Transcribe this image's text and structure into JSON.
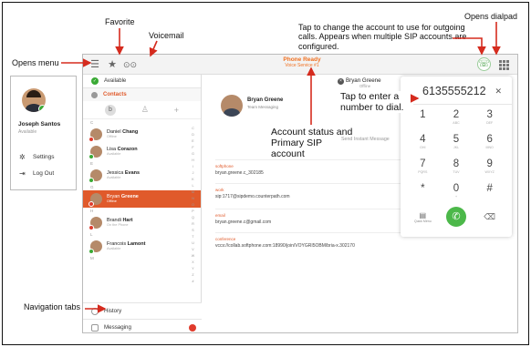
{
  "annotations": {
    "favorite": "Favorite",
    "voicemail": "Voicemail",
    "opens_menu": "Opens menu",
    "change_account": "Tap to change the account to use for outgoing calls. Appears when multiple SIP accounts are configured.",
    "opens_dialpad": "Opens dialpad",
    "tap_enter": "Tap to enter a number to dial.",
    "account_status": "Account status and Primary SIP account",
    "navigation_tabs": "Navigation tabs"
  },
  "topbar": {
    "status": "Phone Ready",
    "service": "Voice Service #1"
  },
  "menu": {
    "user_name": "Joseph Santos",
    "user_status": "Available",
    "settings": "Settings",
    "logout": "Log Out"
  },
  "contacts": {
    "availability": "Available",
    "header": "Contacts",
    "groups": [
      {
        "letter": "C",
        "rows": [
          {
            "first": "Daniel",
            "last": "Chang",
            "status": "Offline",
            "color": "#e03b2c"
          },
          {
            "first": "Lisa",
            "last": "Corazon",
            "status": "Available",
            "color": "#3aaa35"
          }
        ]
      },
      {
        "letter": "E",
        "rows": [
          {
            "first": "Jessica",
            "last": "Evans",
            "status": "Available",
            "color": "#3aaa35"
          }
        ]
      },
      {
        "letter": "G",
        "rows": [
          {
            "first": "Bryan",
            "last": "Greene",
            "status": "Offline",
            "color": "#e03b2c",
            "selected": true
          }
        ]
      },
      {
        "letter": "H",
        "rows": [
          {
            "first": "Brandi",
            "last": "Hart",
            "status": "On the Phone",
            "color": "#e03b2c"
          }
        ]
      },
      {
        "letter": "L",
        "rows": [
          {
            "first": "Francois",
            "last": "Lamont",
            "status": "Available",
            "color": "#3aaa35"
          }
        ]
      }
    ],
    "last_letter": "M",
    "index_letters": [
      "C",
      "D",
      "E",
      "F",
      "G",
      "H",
      "I",
      "J",
      "K",
      "L",
      "M",
      "N",
      "O",
      "P",
      "Q",
      "R",
      "S",
      "T",
      "U",
      "V",
      "W",
      "X",
      "Y",
      "Z",
      "#"
    ]
  },
  "nav": {
    "history": "History",
    "messaging": "Messaging"
  },
  "detail": {
    "name": "Bryan Greene",
    "subtitle": "Team Messaging",
    "top_name": "Bryan Greene",
    "top_status": "Offline",
    "send_im": "Send Instant Message",
    "fields": [
      {
        "key": "softphone",
        "value": "bryan.greene.c_302185"
      },
      {
        "key": "work",
        "value": "sip:1717@sipdemo.counterpath.com"
      },
      {
        "key": "email",
        "value": "bryan.greene.c@gmail.com"
      },
      {
        "key": "conference",
        "value": "vccs://collab.softphone.com:18990/join/VOYGRI5OBM/bria-x.302170"
      }
    ]
  },
  "dialpad": {
    "number": "6135555212",
    "keys": [
      {
        "d": "1",
        "l": ""
      },
      {
        "d": "2",
        "l": "ABC"
      },
      {
        "d": "3",
        "l": "DEF"
      },
      {
        "d": "4",
        "l": "GHI"
      },
      {
        "d": "5",
        "l": "JKL"
      },
      {
        "d": "6",
        "l": "MNO"
      },
      {
        "d": "7",
        "l": "PQRS"
      },
      {
        "d": "8",
        "l": "TUV"
      },
      {
        "d": "9",
        "l": "WXYZ"
      },
      {
        "d": "*",
        "l": ""
      },
      {
        "d": "0",
        "l": "+"
      },
      {
        "d": "#",
        "l": ""
      }
    ],
    "quick_menu": "Quick Menu"
  }
}
